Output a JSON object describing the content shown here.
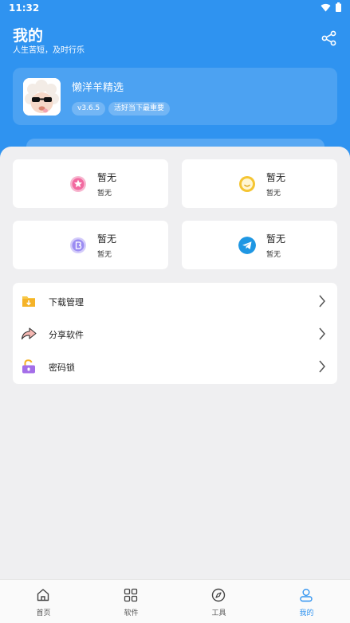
{
  "status_bar": {
    "time": "11:32"
  },
  "header": {
    "title": "我的",
    "subtitle": "人生苦短，及时行乐"
  },
  "profile": {
    "app_name": "懒洋羊精选",
    "version": "v3.6.5",
    "motto": "活好当下最重要"
  },
  "stats": [
    {
      "title": "暂无",
      "sub": "暂无",
      "icon": "star-badge-icon",
      "color": "#f26aa0"
    },
    {
      "title": "暂无",
      "sub": "暂无",
      "icon": "smile-face-icon",
      "color": "#f5c533"
    },
    {
      "title": "暂无",
      "sub": "暂无",
      "icon": "b-coin-icon",
      "color": "#9b8cf2"
    },
    {
      "title": "暂无",
      "sub": "暂无",
      "icon": "telegram-icon",
      "color": "#1f97e3"
    }
  ],
  "menu": [
    {
      "label": "下载管理",
      "icon": "download-folder-icon"
    },
    {
      "label": "分享软件",
      "icon": "share-arrow-icon"
    },
    {
      "label": "密码锁",
      "icon": "unlock-icon"
    }
  ],
  "tabs": [
    {
      "label": "首页",
      "icon": "home-icon"
    },
    {
      "label": "软件",
      "icon": "grid-icon"
    },
    {
      "label": "工具",
      "icon": "compass-icon"
    },
    {
      "label": "我的",
      "icon": "user-icon",
      "active": true
    }
  ],
  "colors": {
    "accent": "#2f93f0",
    "background": "#efeff1"
  }
}
